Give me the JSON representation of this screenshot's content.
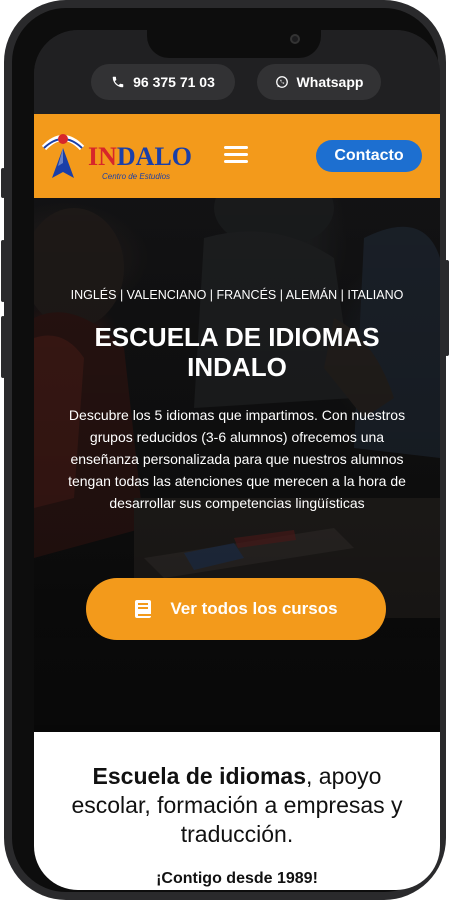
{
  "topbar": {
    "phone_label": "96 375 71 03",
    "phone_icon": "phone-icon",
    "whatsapp_label": "Whatsapp",
    "whatsapp_icon": "whatsapp-icon"
  },
  "header": {
    "logo_text_accent": "IN",
    "logo_text_rest": "DALO",
    "logo_subtitle": "Centro de Estudios",
    "menu_icon": "hamburger-menu-icon",
    "contact_label": "Contacto"
  },
  "hero": {
    "languages": "INGLÉS | VALENCIANO | FRANCÉS | ALEMÁN | ITALIANO",
    "title": "ESCUELA DE IDIOMAS INDALO",
    "description": "Descubre los 5 idiomas que impartimos. Con nuestros grupos reducidos (3-6 alumnos) ofrecemos una enseñanza personalizada para que nuestros alumnos tengan todas las atenciones que merecen a la hora de desarrollar sus competencias lingüísticas",
    "cta_label": "Ver todos los cursos",
    "cta_icon": "book-icon"
  },
  "intro": {
    "tagline_bold": "Escuela de idiomas",
    "tagline_rest": ", apoyo escolar, formación a empresas y traducción.",
    "since": "¡Contigo desde 1989!"
  },
  "colors": {
    "brand_orange": "#f39a1b",
    "brand_blue": "#1d6fd0",
    "logo_blue": "#1a3fa8",
    "logo_red": "#d7262a"
  }
}
